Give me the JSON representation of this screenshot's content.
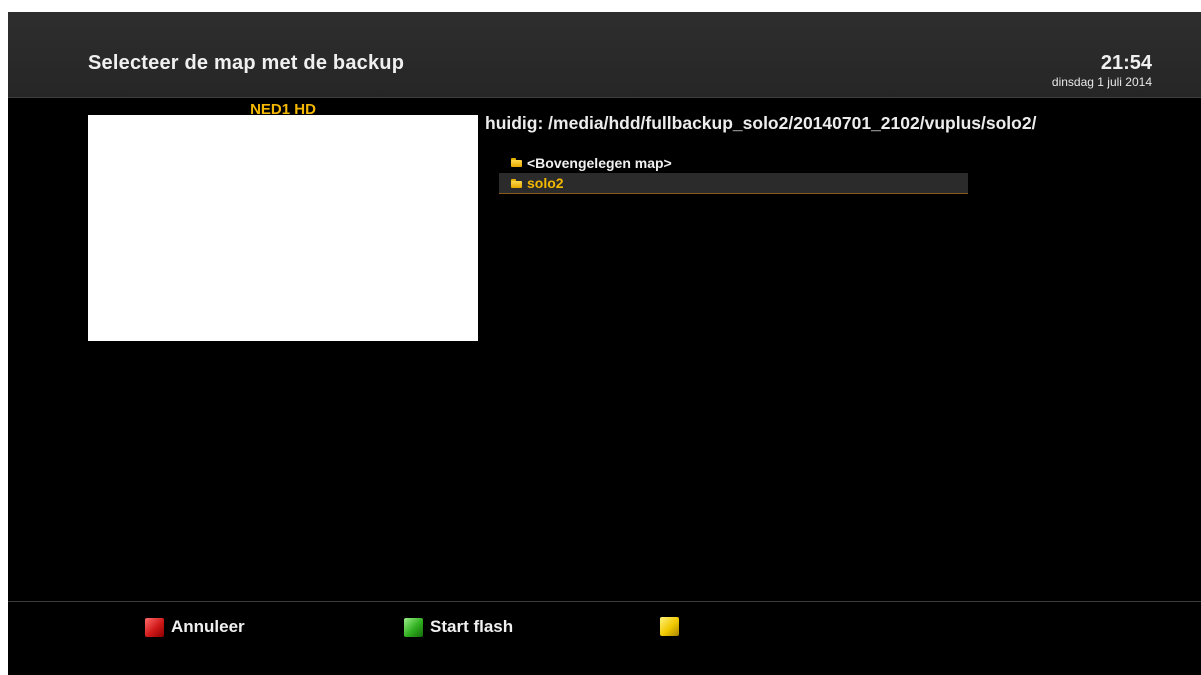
{
  "header": {
    "title": "Selecteer de map met de backup",
    "time": "21:54",
    "date": "dinsdag  1 juli 2014"
  },
  "preview": {
    "channel_name": "NED1 HD"
  },
  "browser": {
    "current_path": "huidig:  /media/hdd/fullbackup_solo2/20140701_2102/vuplus/solo2/",
    "items": [
      {
        "label": "<Bovengelegen map>",
        "icon": "folder-icon",
        "selected": false
      },
      {
        "label": "solo2",
        "icon": "folder-icon",
        "selected": true
      }
    ]
  },
  "footer": {
    "red_label": "Annuleer",
    "green_label": "Start flash",
    "yellow_label": ""
  },
  "colors": {
    "accent": "#f4b800",
    "red_key": "#d01818",
    "green_key": "#2fae1f",
    "yellow_key": "#f0c800"
  }
}
